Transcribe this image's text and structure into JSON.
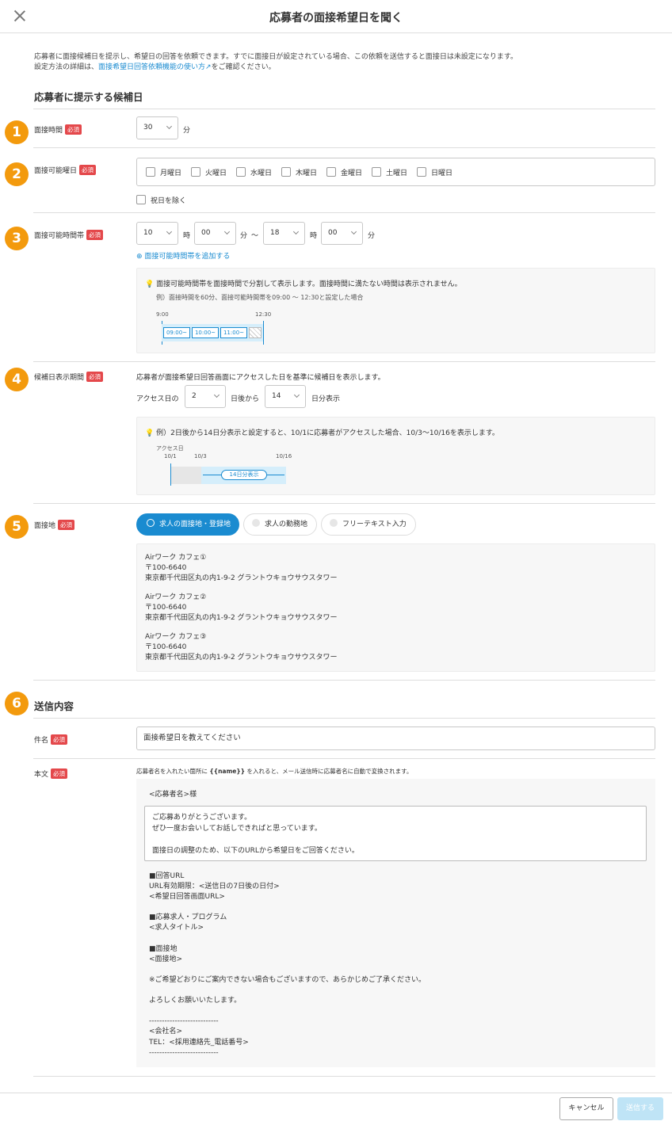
{
  "header": {
    "title": "応募者の面接希望日を聞く"
  },
  "intro": {
    "line1": "応募者に面接候補日を提示し、希望日の回答を依頼できます。すでに面接日が設定されている場合、この依頼を送信すると面接日は未設定になります。",
    "line2_prefix": "設定方法の詳細は、",
    "link": "面接希望日回答依頼機能の使い方",
    "line2_suffix": "をご確認ください。"
  },
  "section1_title": "応募者に提示する候補日",
  "required": "必須",
  "step_numbers": [
    "1",
    "2",
    "3",
    "4",
    "5",
    "6"
  ],
  "duration": {
    "label": "面接時間",
    "value": "30",
    "unit": "分"
  },
  "weekdays": {
    "label": "面接可能曜日",
    "days": [
      "月曜日",
      "火曜日",
      "水曜日",
      "木曜日",
      "金曜日",
      "土曜日",
      "日曜日"
    ],
    "holiday": "祝日を除く"
  },
  "timerange": {
    "label": "面接可能時間帯",
    "start_h": "10",
    "start_m": "00",
    "end_h": "18",
    "end_m": "00",
    "hour_unit": "時",
    "min_unit": "分",
    "tilde": "〜",
    "add_link": "面接可能時間帯を追加する",
    "tip": "面接可能時間帯を面接時間で分割して表示します。面接時間に満たない時間は表示されません。",
    "example": "例）面接時間を60分、面接可能時間帯を09:00 〜 12:30と設定した場合",
    "start_label": "9:00",
    "end_label": "12:30",
    "slots": [
      "09:00~",
      "10:00~",
      "11:00~"
    ]
  },
  "period": {
    "label": "候補日表示期間",
    "desc": "応募者が面接希望日回答画面にアクセスした日を基準に候補日を表示します。",
    "prefix": "アクセス日の",
    "offset": "2",
    "mid": "日後から",
    "days": "14",
    "suffix": "日分表示",
    "tip": "例）2日後から14日分表示と設定すると、10/1に応募者がアクセスした場合、10/3〜10/16を表示します。",
    "access_label": "アクセス日",
    "d1": "10/1",
    "d2": "10/3",
    "d3": "10/16",
    "range_label": "14日分表示"
  },
  "location": {
    "label": "面接地",
    "options": [
      "求人の面接地・登録地",
      "求人の勤務地",
      "フリーテキスト入力"
    ],
    "places": [
      {
        "name": "Airワーク カフェ①",
        "zip": "〒100-6640",
        "addr": "東京都千代田区丸の内1-9-2 グラントウキョウサウスタワー"
      },
      {
        "name": "Airワーク カフェ②",
        "zip": "〒100-6640",
        "addr": "東京都千代田区丸の内1-9-2 グラントウキョウサウスタワー"
      },
      {
        "name": "Airワーク カフェ③",
        "zip": "〒100-6640",
        "addr": "東京都千代田区丸の内1-9-2 グラントウキョウサウスタワー"
      }
    ]
  },
  "section2_title": "送信内容",
  "subject": {
    "label": "件名",
    "value": "面接希望日を教えてください"
  },
  "body": {
    "label": "本文",
    "hint_prefix": "応募者名を入れたい箇所に ",
    "hint_token": "{{name}}",
    "hint_suffix": " を入れると、メール送信時に応募者名に自動で変換されます。",
    "greeting": "<応募者名>様",
    "textarea": "ご応募ありがとうございます。\nぜひ一度お会いしてお話しできればと思っています。\n\n面接日の調整のため、以下のURLから希望日をご回答ください。",
    "fixed": "■回答URL\nURL有効期限：<送信日の7日後の日付>\n<希望日回答画面URL>\n\n■応募求人・プログラム\n<求人タイトル>\n\n■面接地\n<面接地>\n\n※ご希望どおりにご案内できない場合もございますので、あらかじめご了承ください。\n\nよろしくお願いいたします。\n\n---------------------------\n<会社名>\nTEL：<採用連絡先_電話番号>\n---------------------------"
  },
  "footer": {
    "cancel": "キャンセル",
    "send": "送信する"
  }
}
